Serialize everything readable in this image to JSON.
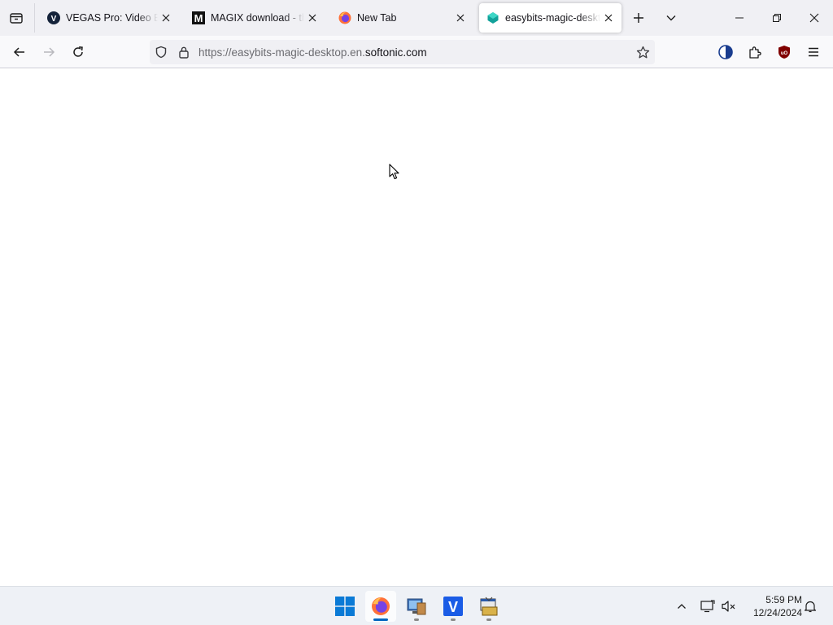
{
  "browser": {
    "tabs": [
      {
        "title": "VEGAS Pro: Video Editi",
        "favicon": "vegas-logo-icon",
        "active": false
      },
      {
        "title": "MAGIX download - tha",
        "favicon": "magix-logo-icon",
        "active": false
      },
      {
        "title": "New Tab",
        "favicon": "firefox-logo-icon",
        "active": false
      },
      {
        "title": "easybits-magic-deskto",
        "favicon": "softonic-logo-icon",
        "active": true
      }
    ],
    "address": {
      "prefix": "https://easybits-magic-desktop.en.",
      "host": "softonic.com"
    },
    "icons": {
      "back": "back-arrow-icon",
      "forward": "forward-arrow-icon",
      "reload": "reload-icon",
      "tracking": "tracking-protection-shield-icon",
      "lock": "lock-icon",
      "bookmark": "bookmark-star-icon",
      "dark_reader": "dark-mode-extension-icon",
      "extensions": "extensions-puzzle-icon",
      "ublock": "ublock-origin-icon",
      "menu": "hamburger-menu-icon"
    }
  },
  "taskbar": {
    "apps": [
      {
        "name": "Start",
        "icon": "windows-start-icon"
      },
      {
        "name": "Firefox",
        "icon": "firefox-icon",
        "active": true
      },
      {
        "name": "Installer",
        "icon": "installer-icon"
      },
      {
        "name": "VEGAS Pro",
        "icon": "vegas-icon"
      },
      {
        "name": "Setup",
        "icon": "setup-package-icon"
      }
    ],
    "clock": {
      "time": "5:59 PM",
      "date": "12/24/2024"
    }
  },
  "colors": {
    "accent": "#0060df",
    "tabstrip": "#f0f0f4",
    "navbar": "#f9f9fb",
    "taskbar": "#eef1f6"
  }
}
